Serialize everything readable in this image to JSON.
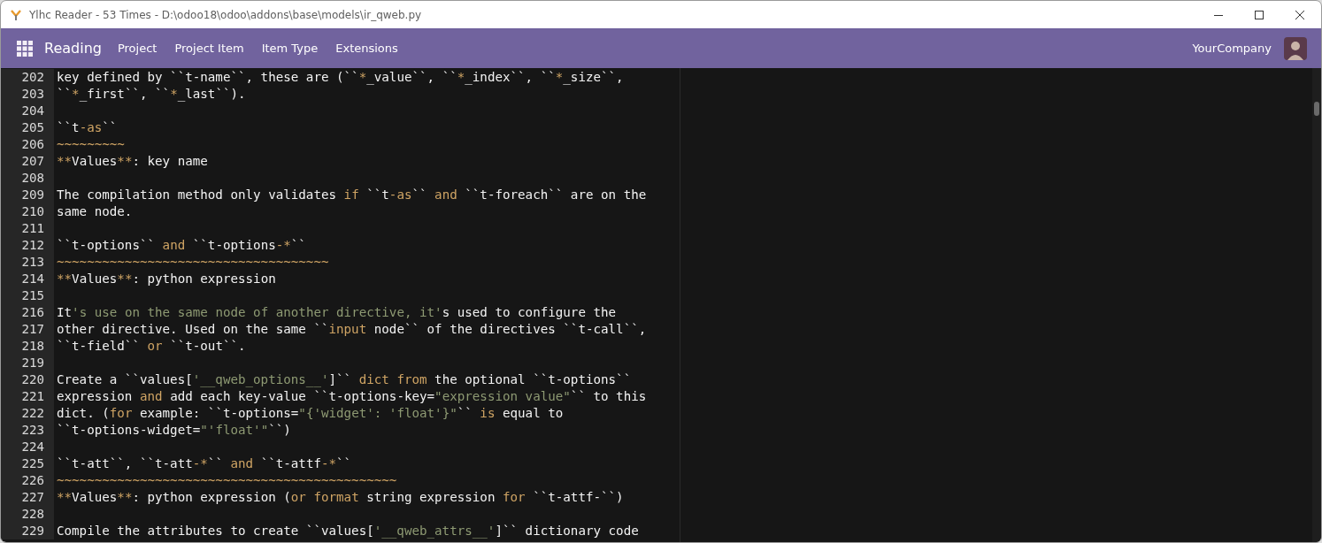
{
  "window": {
    "title": "Ylhc Reader - 53 Times - D:\\odoo18\\odoo\\addons\\base\\models\\ir_qweb.py"
  },
  "navbar": {
    "app_name": "Reading",
    "menu": [
      {
        "label": "Project"
      },
      {
        "label": "Project Item"
      },
      {
        "label": "Item Type"
      },
      {
        "label": "Extensions"
      }
    ],
    "company": "YourCompany"
  },
  "editor": {
    "lines": [
      {
        "number": "202",
        "segments": [
          {
            "kind": "text",
            "text": "key defined by ``t-name``, these are (``"
          },
          {
            "kind": "keyword",
            "text": "*"
          },
          {
            "kind": "text",
            "text": "_value``, ``"
          },
          {
            "kind": "keyword",
            "text": "*"
          },
          {
            "kind": "text",
            "text": "_index``, ``"
          },
          {
            "kind": "keyword",
            "text": "*"
          },
          {
            "kind": "text",
            "text": "_size``,"
          }
        ]
      },
      {
        "number": "203",
        "segments": [
          {
            "kind": "text",
            "text": "``"
          },
          {
            "kind": "keyword",
            "text": "*"
          },
          {
            "kind": "text",
            "text": "_first``, ``"
          },
          {
            "kind": "keyword",
            "text": "*"
          },
          {
            "kind": "text",
            "text": "_last``)."
          }
        ]
      },
      {
        "number": "204"
      },
      {
        "number": "205",
        "segments": [
          {
            "kind": "text",
            "text": "``t"
          },
          {
            "kind": "keyword",
            "text": "-as"
          },
          {
            "kind": "text",
            "text": "``"
          }
        ]
      },
      {
        "number": "206",
        "segments": [
          {
            "kind": "keyword",
            "text": "~~~~~~~~~"
          }
        ]
      },
      {
        "number": "207",
        "segments": [
          {
            "kind": "keyword",
            "text": "**"
          },
          {
            "kind": "text",
            "text": "Values"
          },
          {
            "kind": "keyword",
            "text": "**"
          },
          {
            "kind": "text",
            "text": ": key name"
          }
        ]
      },
      {
        "number": "208"
      },
      {
        "number": "209",
        "segments": [
          {
            "kind": "text",
            "text": "The compilation method only validates "
          },
          {
            "kind": "keyword",
            "text": "if"
          },
          {
            "kind": "text",
            "text": " ``t"
          },
          {
            "kind": "keyword",
            "text": "-as"
          },
          {
            "kind": "text",
            "text": "`` "
          },
          {
            "kind": "keyword",
            "text": "and"
          },
          {
            "kind": "text",
            "text": " ``t-foreach`` are on the"
          }
        ]
      },
      {
        "number": "210",
        "segments": [
          {
            "kind": "text",
            "text": "same node."
          }
        ]
      },
      {
        "number": "211"
      },
      {
        "number": "212",
        "segments": [
          {
            "kind": "text",
            "text": "``t-options`` "
          },
          {
            "kind": "keyword",
            "text": "and"
          },
          {
            "kind": "text",
            "text": " ``t-options"
          },
          {
            "kind": "keyword",
            "text": "-*"
          },
          {
            "kind": "text",
            "text": "``"
          }
        ]
      },
      {
        "number": "213",
        "segments": [
          {
            "kind": "keyword",
            "text": "~~~~~~~~~~~~~~~~~~~~~~~~~~~~~~~~~~~~"
          }
        ]
      },
      {
        "number": "214",
        "segments": [
          {
            "kind": "keyword",
            "text": "**"
          },
          {
            "kind": "text",
            "text": "Values"
          },
          {
            "kind": "keyword",
            "text": "**"
          },
          {
            "kind": "text",
            "text": ": python expression"
          }
        ]
      },
      {
        "number": "215"
      },
      {
        "number": "216",
        "segments": [
          {
            "kind": "text",
            "text": "It"
          },
          {
            "kind": "string",
            "text": "'s use on the same node of another directive, it'"
          },
          {
            "kind": "text",
            "text": "s used to configure the"
          }
        ]
      },
      {
        "number": "217",
        "segments": [
          {
            "kind": "text",
            "text": "other directive. Used on the same ``"
          },
          {
            "kind": "keyword",
            "text": "input"
          },
          {
            "kind": "text",
            "text": " node`` of the directives ``t-call``,"
          }
        ]
      },
      {
        "number": "218",
        "segments": [
          {
            "kind": "text",
            "text": "``t-field`` "
          },
          {
            "kind": "keyword",
            "text": "or"
          },
          {
            "kind": "text",
            "text": " ``t-out``."
          }
        ]
      },
      {
        "number": "219"
      },
      {
        "number": "220",
        "segments": [
          {
            "kind": "text",
            "text": "Create a ``values["
          },
          {
            "kind": "string",
            "text": "'__qweb_options__'"
          },
          {
            "kind": "text",
            "text": "]`` "
          },
          {
            "kind": "keyword",
            "text": "dict from"
          },
          {
            "kind": "text",
            "text": " the optional ``t-options``"
          }
        ]
      },
      {
        "number": "221",
        "segments": [
          {
            "kind": "text",
            "text": "expression "
          },
          {
            "kind": "keyword",
            "text": "and"
          },
          {
            "kind": "text",
            "text": " add each key-value ``t-options-key="
          },
          {
            "kind": "string",
            "text": "\"expression value\""
          },
          {
            "kind": "text",
            "text": "`` to this"
          }
        ]
      },
      {
        "number": "222",
        "segments": [
          {
            "kind": "text",
            "text": "dict. ("
          },
          {
            "kind": "keyword",
            "text": "for"
          },
          {
            "kind": "text",
            "text": " example: ``t-options="
          },
          {
            "kind": "string",
            "text": "\"{'widget': 'float'}\""
          },
          {
            "kind": "text",
            "text": "`` "
          },
          {
            "kind": "keyword",
            "text": "is"
          },
          {
            "kind": "text",
            "text": " equal to"
          }
        ]
      },
      {
        "number": "223",
        "segments": [
          {
            "kind": "text",
            "text": "``t-options-widget="
          },
          {
            "kind": "string",
            "text": "\"'float'\""
          },
          {
            "kind": "text",
            "text": "``)"
          }
        ]
      },
      {
        "number": "224"
      },
      {
        "number": "225",
        "segments": [
          {
            "kind": "text",
            "text": "``t-att``, ``t-att"
          },
          {
            "kind": "keyword",
            "text": "-*"
          },
          {
            "kind": "text",
            "text": "`` "
          },
          {
            "kind": "keyword",
            "text": "and"
          },
          {
            "kind": "text",
            "text": " ``t-attf"
          },
          {
            "kind": "keyword",
            "text": "-*"
          },
          {
            "kind": "text",
            "text": "``"
          }
        ]
      },
      {
        "number": "226",
        "segments": [
          {
            "kind": "keyword",
            "text": "~~~~~~~~~~~~~~~~~~~~~~~~~~~~~~~~~~~~~~~~~~~~~"
          }
        ]
      },
      {
        "number": "227",
        "segments": [
          {
            "kind": "keyword",
            "text": "**"
          },
          {
            "kind": "text",
            "text": "Values"
          },
          {
            "kind": "keyword",
            "text": "**"
          },
          {
            "kind": "text",
            "text": ": python expression ("
          },
          {
            "kind": "keyword",
            "text": "or format"
          },
          {
            "kind": "text",
            "text": " string expression "
          },
          {
            "kind": "keyword",
            "text": "for"
          },
          {
            "kind": "text",
            "text": " ``t-attf-``)"
          }
        ]
      },
      {
        "number": "228"
      },
      {
        "number": "229",
        "segments": [
          {
            "kind": "text",
            "text": "Compile the attributes to create ``values["
          },
          {
            "kind": "string",
            "text": "'__qweb_attrs__'"
          },
          {
            "kind": "text",
            "text": "]`` dictionary code"
          }
        ]
      }
    ]
  }
}
